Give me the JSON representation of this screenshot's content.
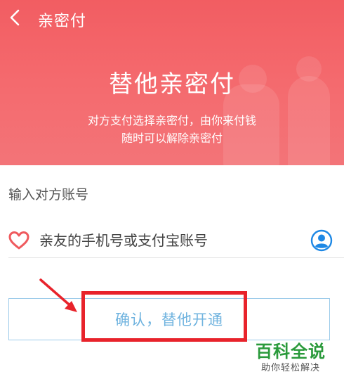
{
  "nav": {
    "title": "亲密付"
  },
  "hero": {
    "title": "替他亲密付",
    "subtitle_line1": "对方支付选择亲密付，由你来付钱",
    "subtitle_line2": "随时可以解除亲密付"
  },
  "form": {
    "section_label": "输入对方账号",
    "account_placeholder": "亲友的手机号或支付宝账号",
    "account_value": ""
  },
  "confirm_button": {
    "label": "确认，替他开通"
  },
  "watermark": {
    "main": "百科全说",
    "sub": "助你轻松解决"
  },
  "colors": {
    "header_bg": "#f25d62",
    "button_text": "#6fb3df",
    "button_border": "#9ccbea",
    "highlight": "#e8232b",
    "heart": "#ef5a5e",
    "contact_icon": "#1e88e5",
    "watermark": "#2a9a3b"
  },
  "icons": [
    "back-arrow-icon",
    "heart-icon",
    "contact-icon",
    "annotation-arrow"
  ]
}
